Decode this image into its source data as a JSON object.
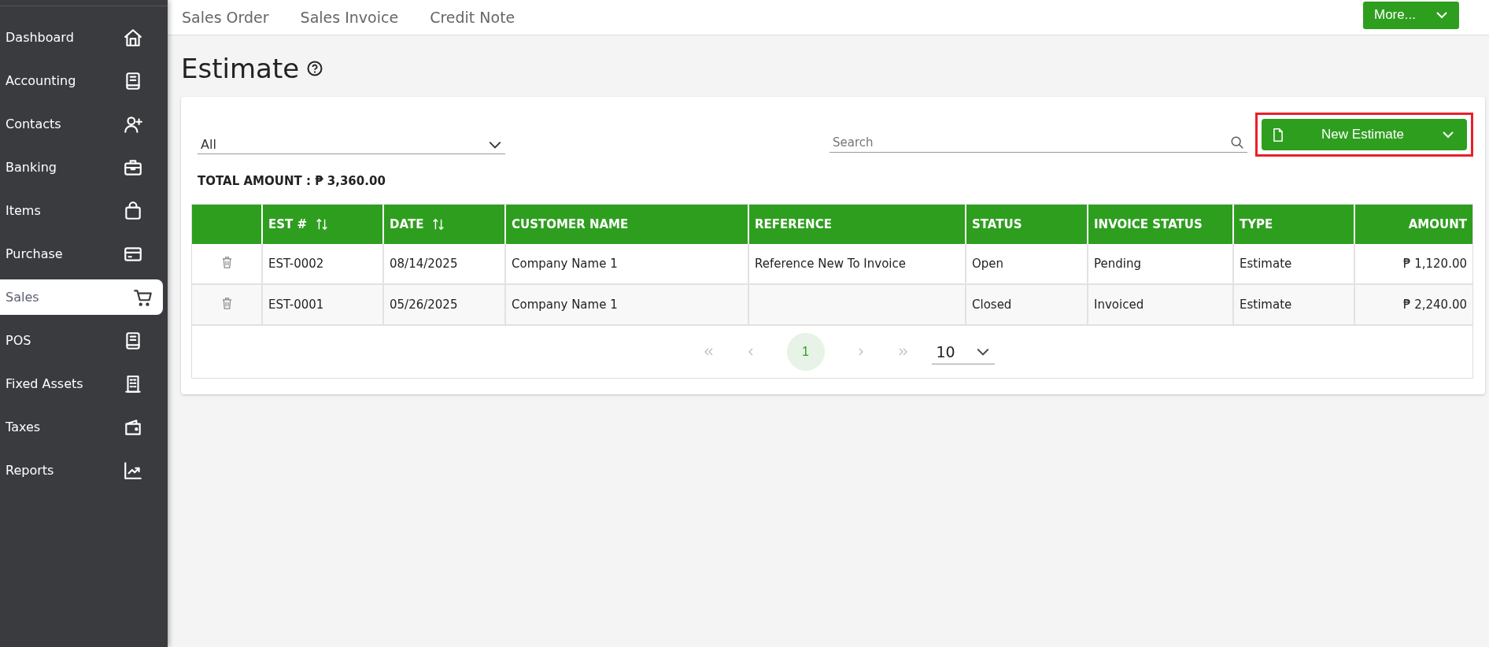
{
  "sidebar": {
    "items": [
      {
        "label": "Dashboard",
        "selected": false
      },
      {
        "label": "Accounting",
        "selected": false
      },
      {
        "label": "Contacts",
        "selected": false
      },
      {
        "label": "Banking",
        "selected": false
      },
      {
        "label": "Items",
        "selected": false
      },
      {
        "label": "Purchase",
        "selected": false
      },
      {
        "label": "Sales",
        "selected": true
      },
      {
        "label": "POS",
        "selected": false
      },
      {
        "label": "Fixed Assets",
        "selected": false
      },
      {
        "label": "Taxes",
        "selected": false
      },
      {
        "label": "Reports",
        "selected": false
      }
    ]
  },
  "top_links": [
    "Sales Order",
    "Sales Invoice",
    "Credit Note"
  ],
  "more_button": {
    "label": "More..."
  },
  "page": {
    "title": "Estimate"
  },
  "filter": {
    "value": "All"
  },
  "search": {
    "placeholder": "Search"
  },
  "new_button": {
    "label": "New Estimate",
    "highlighted": true
  },
  "total": "TOTAL AMOUNT : ₱ 3,360.00",
  "table": {
    "columns": [
      {
        "label": "EST #",
        "sortable": true
      },
      {
        "label": "DATE",
        "sortable": true
      },
      {
        "label": "CUSTOMER NAME",
        "sortable": false
      },
      {
        "label": "REFERENCE",
        "sortable": false
      },
      {
        "label": "STATUS",
        "sortable": false
      },
      {
        "label": "INVOICE STATUS",
        "sortable": false
      },
      {
        "label": "TYPE",
        "sortable": false
      },
      {
        "label": "AMOUNT",
        "sortable": false
      }
    ],
    "rows": [
      {
        "cells": [
          "EST-0002",
          "08/14/2025",
          "Company Name 1",
          "Reference New To Invoice",
          "Open",
          "Pending",
          "Estimate",
          "₱ 1,120.00"
        ]
      },
      {
        "cells": [
          "EST-0001",
          "05/26/2025",
          "Company Name 1",
          "",
          "Closed",
          "Invoiced",
          "Estimate",
          "₱ 2,240.00"
        ]
      }
    ]
  },
  "pagination": {
    "pages": [
      {
        "label": "1",
        "selected": true
      }
    ],
    "page_size": "10"
  }
}
